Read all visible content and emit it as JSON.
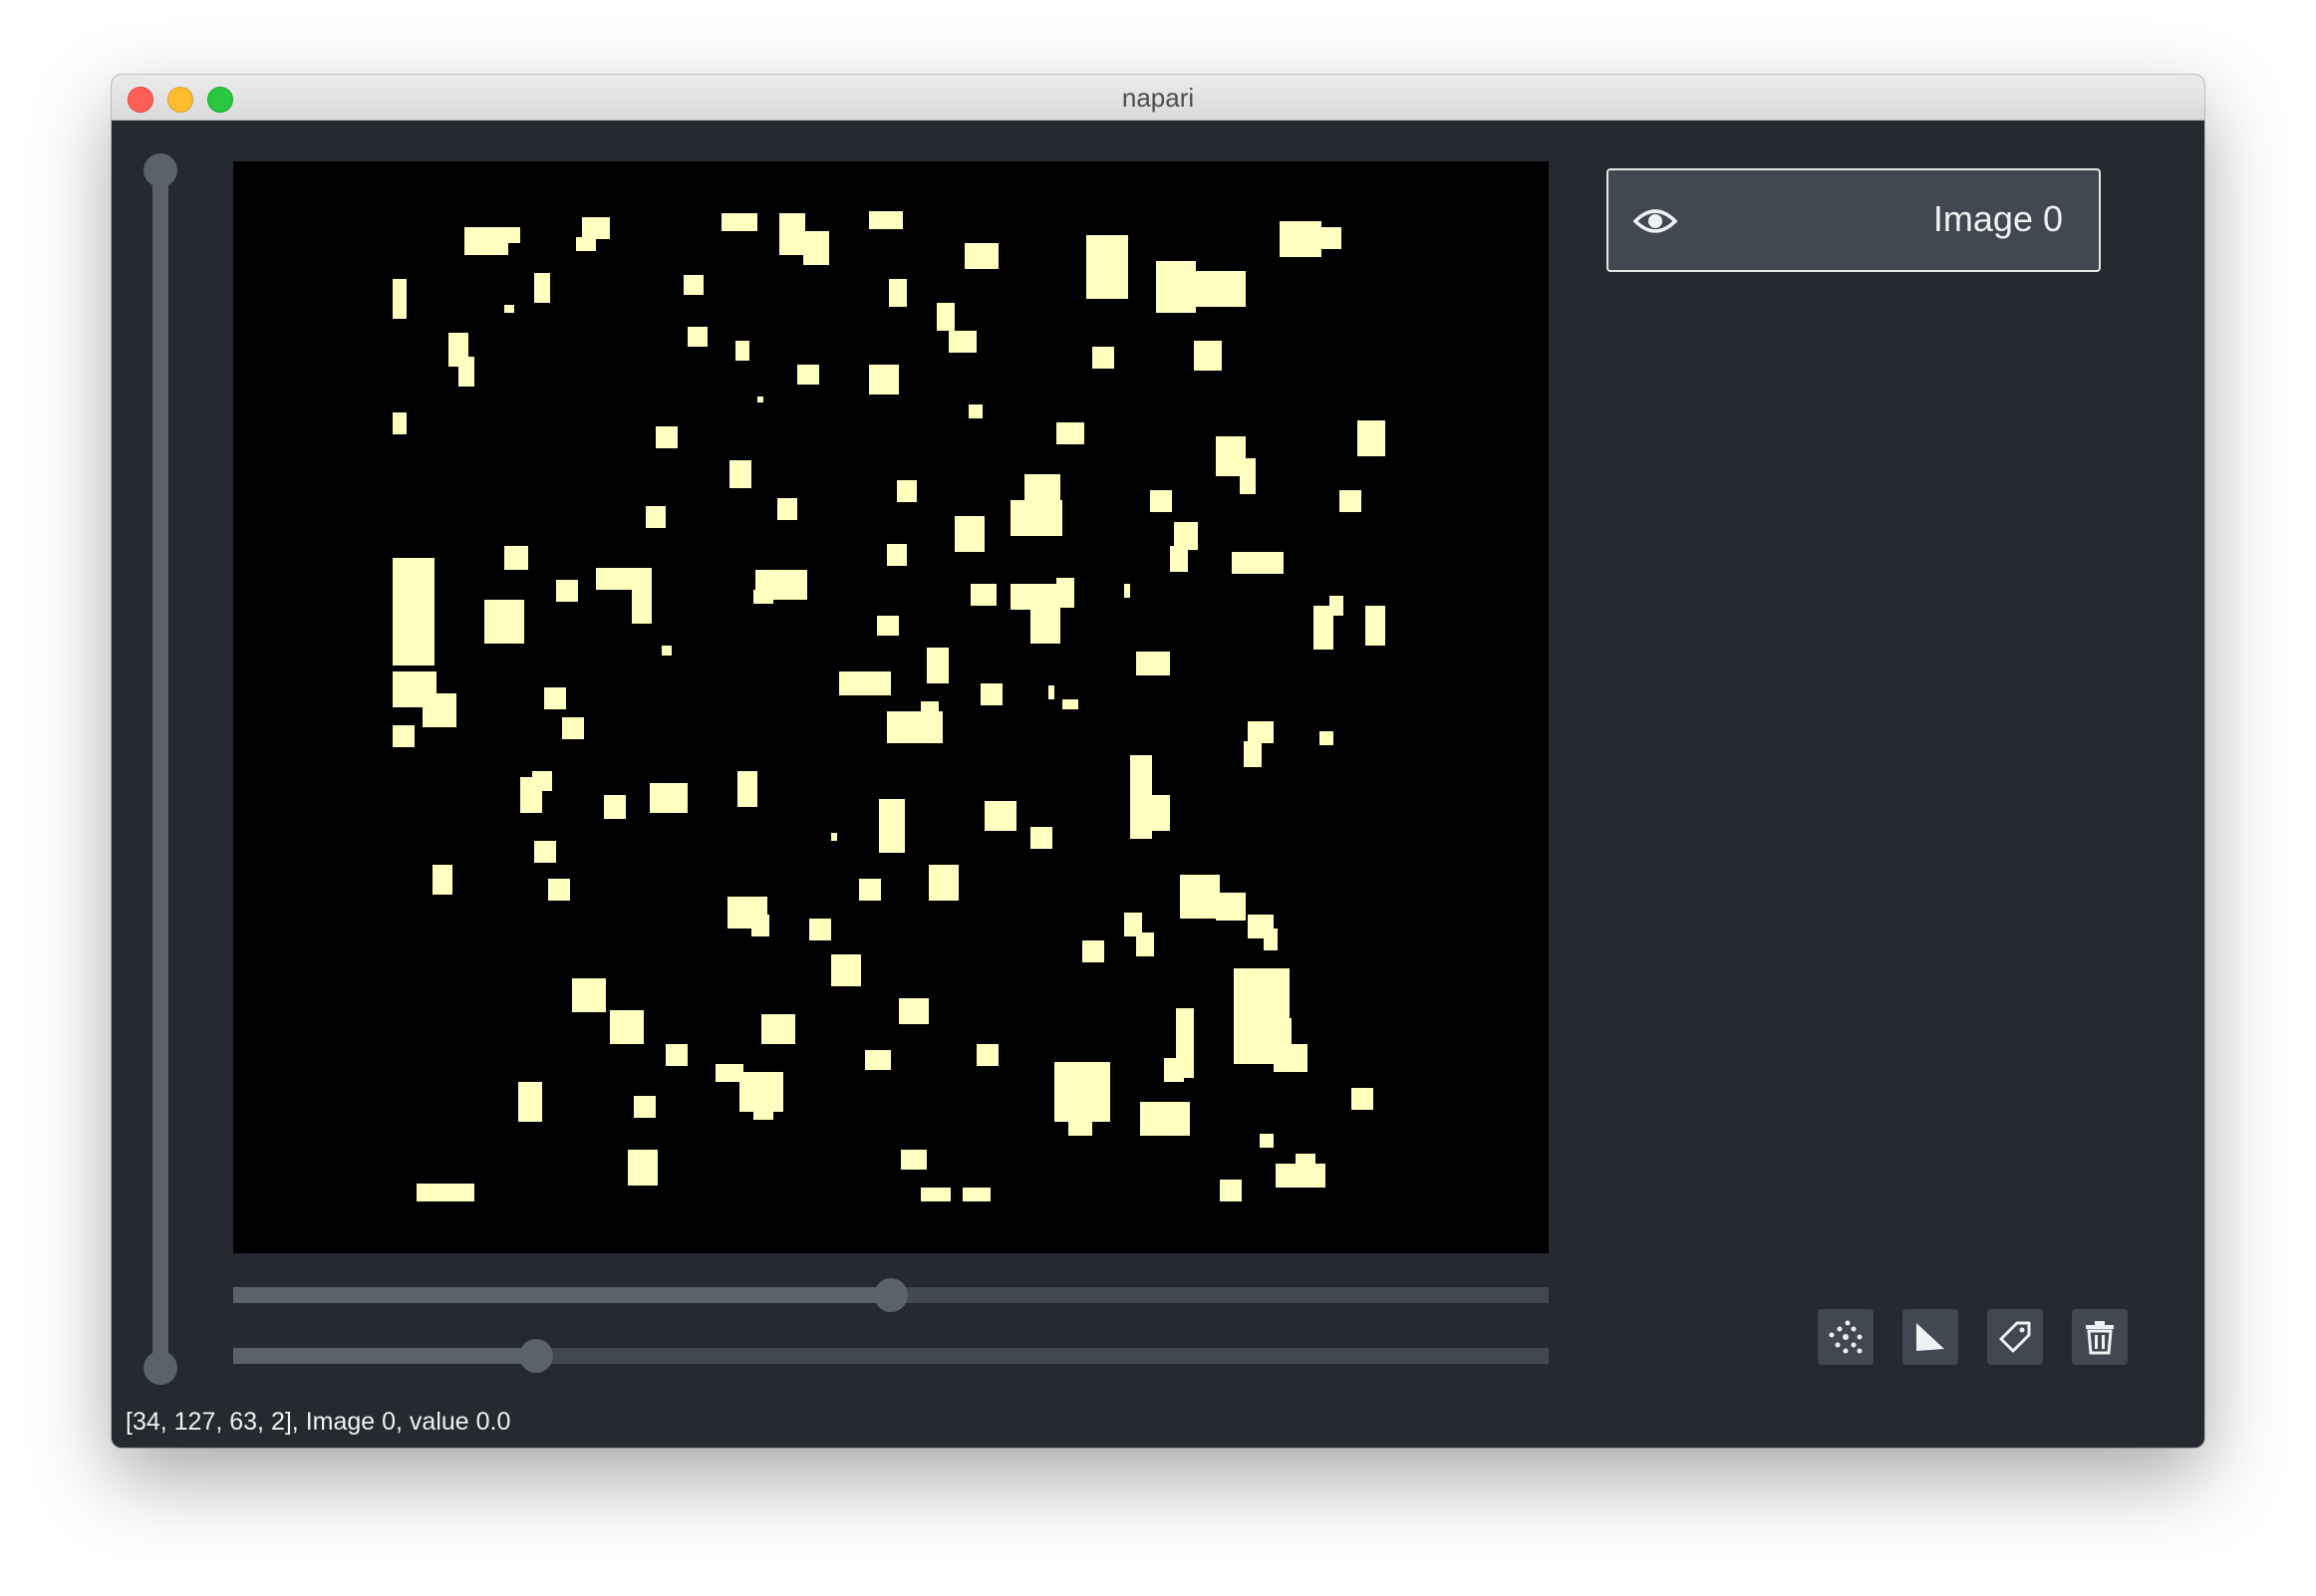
{
  "window": {
    "title": "napari"
  },
  "layers": [
    {
      "name": "Image 0",
      "visible": true,
      "visibility_icon": "eye-icon"
    }
  ],
  "dims_sliders": [
    {
      "orientation": "vertical",
      "value_fraction": 1.0
    },
    {
      "orientation": "horizontal",
      "value_fraction": 0.5
    },
    {
      "orientation": "horizontal",
      "value_fraction": 0.23
    }
  ],
  "layer_buttons": [
    {
      "name": "new-points-button",
      "icon": "points-icon"
    },
    {
      "name": "new-shapes-button",
      "icon": "shapes-icon"
    },
    {
      "name": "new-labels-button",
      "icon": "labels-icon"
    },
    {
      "name": "delete-layer-button",
      "icon": "trash-icon"
    }
  ],
  "status_bar": {
    "text": "[34, 127, 63, 2], Image 0, value 0.0"
  },
  "colors": {
    "background": "#262930",
    "panel": "#414851",
    "slider": "#5a626c",
    "blob": "#ffffc0",
    "canvas": "#000000"
  }
}
